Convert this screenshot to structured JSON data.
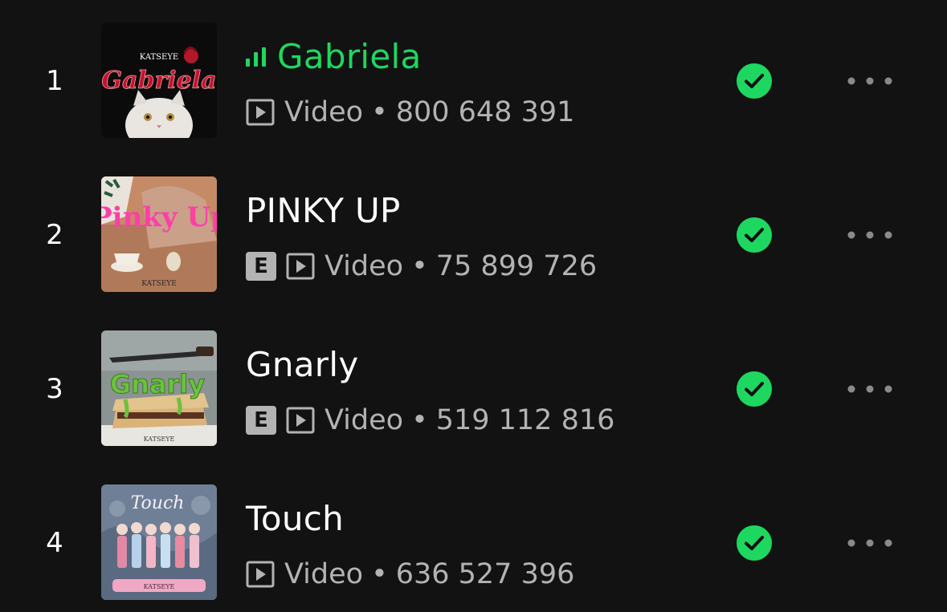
{
  "tracks": [
    {
      "rank": "1",
      "title": "Gabriela",
      "now_playing": true,
      "explicit": false,
      "media_type": "Video",
      "separator": "•",
      "plays": "800 648 391",
      "cover_text": "Gabriela",
      "cover_artist": "KATSEYE"
    },
    {
      "rank": "2",
      "title": "PINKY UP",
      "now_playing": false,
      "explicit": true,
      "explicit_label": "E",
      "media_type": "Video",
      "separator": "•",
      "plays": "75 899 726",
      "cover_text": "Pinky Up",
      "cover_artist": "KATSEYE"
    },
    {
      "rank": "3",
      "title": "Gnarly",
      "now_playing": false,
      "explicit": true,
      "explicit_label": "E",
      "media_type": "Video",
      "separator": "•",
      "plays": "519 112 816",
      "cover_text": "Gnarly",
      "cover_artist": "KATSEYE"
    },
    {
      "rank": "4",
      "title": "Touch",
      "now_playing": false,
      "explicit": false,
      "media_type": "Video",
      "separator": "•",
      "plays": "636 527 396",
      "cover_text": "Touch",
      "cover_artist": "KATSEYE"
    }
  ],
  "icons": {
    "now_playing": "equalizer-icon",
    "media": "video-play-icon",
    "saved": "check-circle-icon",
    "more": "more-options-icon"
  },
  "colors": {
    "background": "#121212",
    "accent": "#1ed760",
    "text_primary": "#ffffff",
    "text_secondary": "#b3b3b3"
  }
}
